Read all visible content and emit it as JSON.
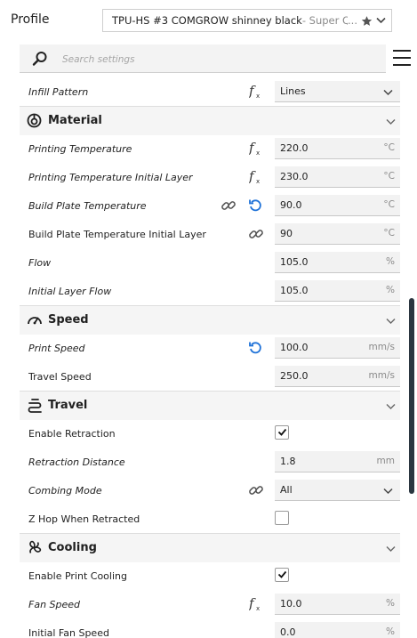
{
  "profile": {
    "label": "Profile",
    "name": "TPU-HS #3 COMGROW shinney black",
    "quality": " - Super Quality - ",
    "ellipsis": "..."
  },
  "search": {
    "placeholder": "Search settings"
  },
  "settings": {
    "infill_pattern": {
      "label": "Infill Pattern",
      "value": "Lines"
    },
    "material": {
      "title": "Material",
      "printing_temperature": {
        "label": "Printing Temperature",
        "value": "220.0",
        "unit": "°C"
      },
      "printing_temperature_initial_layer": {
        "label": "Printing Temperature Initial Layer",
        "value": "230.0",
        "unit": "°C"
      },
      "build_plate_temperature": {
        "label": "Build Plate Temperature",
        "value": "90.0",
        "unit": "°C"
      },
      "build_plate_temperature_initial_layer": {
        "label": "Build Plate Temperature Initial Layer",
        "value": "90",
        "unit": "°C"
      },
      "flow": {
        "label": "Flow",
        "value": "105.0",
        "unit": "%"
      },
      "initial_layer_flow": {
        "label": "Initial Layer Flow",
        "value": "105.0",
        "unit": "%"
      }
    },
    "speed": {
      "title": "Speed",
      "print_speed": {
        "label": "Print Speed",
        "value": "100.0",
        "unit": "mm/s"
      },
      "travel_speed": {
        "label": "Travel Speed",
        "value": "250.0",
        "unit": "mm/s"
      }
    },
    "travel": {
      "title": "Travel",
      "enable_retraction": {
        "label": "Enable Retraction",
        "checked": true
      },
      "retraction_distance": {
        "label": "Retraction Distance",
        "value": "1.8",
        "unit": "mm"
      },
      "combing_mode": {
        "label": "Combing Mode",
        "value": "All"
      },
      "z_hop": {
        "label": "Z Hop When Retracted",
        "checked": false
      }
    },
    "cooling": {
      "title": "Cooling",
      "enable_print_cooling": {
        "label": "Enable Print Cooling",
        "checked": true
      },
      "fan_speed": {
        "label": "Fan Speed",
        "value": "10.0",
        "unit": "%"
      },
      "initial_fan_speed": {
        "label": "Initial Fan Speed",
        "value": "0.0",
        "unit": "%"
      }
    }
  },
  "colors": {
    "accent": "#1f72d8",
    "text": "#1f1f1f",
    "field_bg": "#f2f2f2"
  }
}
